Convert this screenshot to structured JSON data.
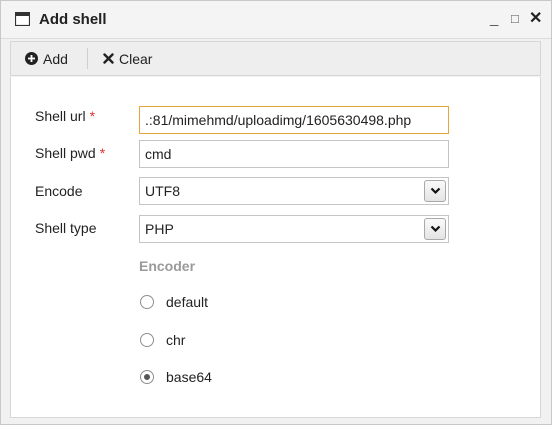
{
  "window": {
    "title": "Add shell",
    "minimize": "_",
    "maximize": "□",
    "close": "✕"
  },
  "toolbar": {
    "add_label": "Add",
    "clear_label": "Clear"
  },
  "form": {
    "shell_url": {
      "label": "Shell url",
      "required": "*",
      "value": ".:81/mimehmd/uploadimg/1605630498.php"
    },
    "shell_pwd": {
      "label": "Shell pwd",
      "required": "*",
      "value": "cmd"
    },
    "encode": {
      "label": "Encode",
      "value": "UTF8"
    },
    "shell_type": {
      "label": "Shell type",
      "value": "PHP"
    },
    "encoder": {
      "label": "Encoder",
      "options": [
        {
          "label": "default",
          "checked": false
        },
        {
          "label": "chr",
          "checked": false
        },
        {
          "label": "base64",
          "checked": true
        }
      ]
    }
  },
  "colors": {
    "required": "#e0312f",
    "focus_border": "#e8a33c",
    "section_label": "#9a9a9a"
  }
}
